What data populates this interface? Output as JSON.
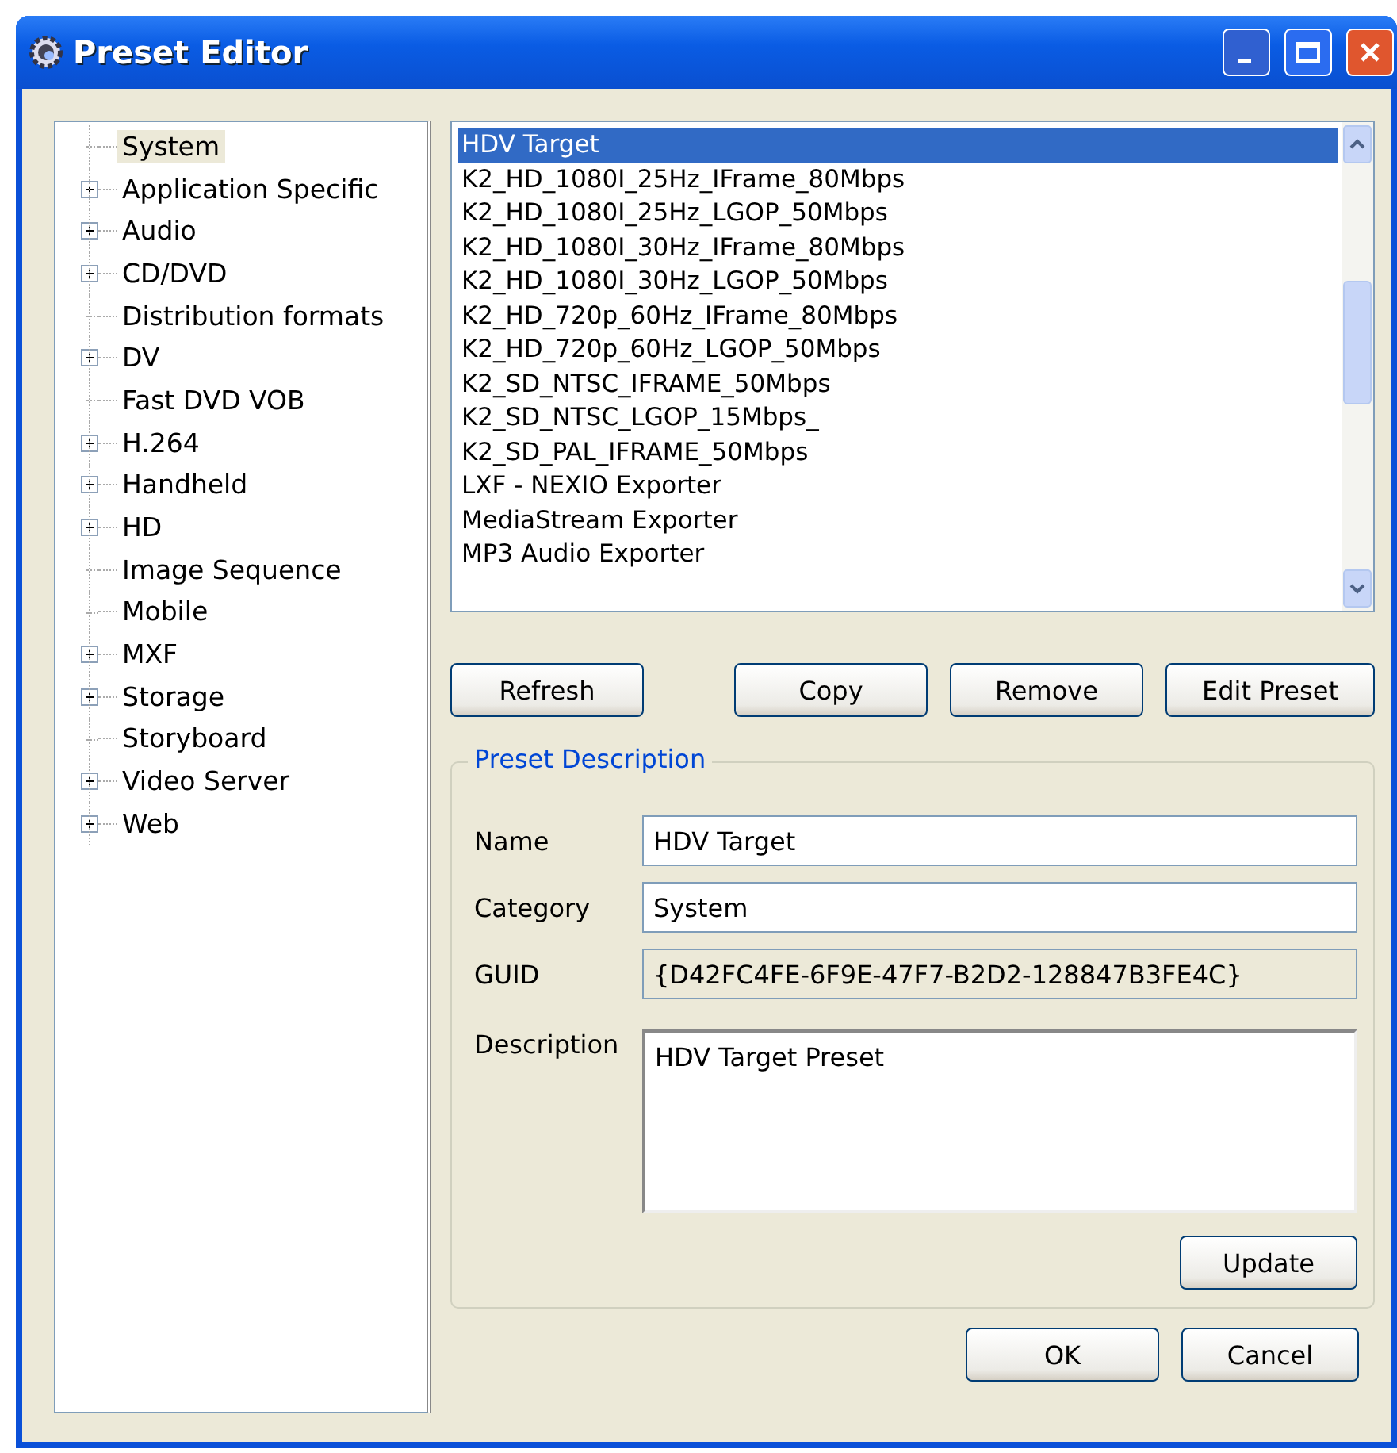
{
  "window": {
    "title": "Preset Editor"
  },
  "tree": {
    "items": [
      {
        "label": "System",
        "kind": "leaf",
        "selected": true
      },
      {
        "label": "Application Specific",
        "kind": "folder",
        "expanded": false,
        "selected": false
      },
      {
        "label": "Audio",
        "kind": "folder",
        "expanded": false,
        "selected": false
      },
      {
        "label": "CD/DVD",
        "kind": "folder",
        "expanded": false,
        "selected": false
      },
      {
        "label": "Distribution formats",
        "kind": "leaf",
        "selected": false
      },
      {
        "label": "DV",
        "kind": "folder",
        "expanded": false,
        "selected": false
      },
      {
        "label": "Fast DVD VOB",
        "kind": "leaf",
        "selected": false
      },
      {
        "label": "H.264",
        "kind": "folder",
        "expanded": false,
        "selected": false
      },
      {
        "label": "Handheld",
        "kind": "folder",
        "expanded": false,
        "selected": false
      },
      {
        "label": "HD",
        "kind": "folder",
        "expanded": false,
        "selected": false
      },
      {
        "label": "Image Sequence",
        "kind": "leaf",
        "selected": false
      },
      {
        "label": "Mobile",
        "kind": "leaf",
        "selected": false
      },
      {
        "label": "MXF",
        "kind": "folder",
        "expanded": false,
        "selected": false
      },
      {
        "label": "Storage",
        "kind": "folder",
        "expanded": false,
        "selected": false
      },
      {
        "label": "Storyboard",
        "kind": "leaf",
        "selected": false
      },
      {
        "label": "Video Server",
        "kind": "folder",
        "expanded": false,
        "selected": false
      },
      {
        "label": "Web",
        "kind": "folder",
        "expanded": false,
        "selected": false
      }
    ]
  },
  "presets": {
    "items": [
      {
        "label": "HDV Target",
        "selected": true
      },
      {
        "label": "K2_HD_1080I_25Hz_IFrame_80Mbps",
        "selected": false
      },
      {
        "label": "K2_HD_1080I_25Hz_LGOP_50Mbps",
        "selected": false
      },
      {
        "label": "K2_HD_1080I_30Hz_IFrame_80Mbps",
        "selected": false
      },
      {
        "label": "K2_HD_1080I_30Hz_LGOP_50Mbps",
        "selected": false
      },
      {
        "label": "K2_HD_720p_60Hz_IFrame_80Mbps",
        "selected": false
      },
      {
        "label": "K2_HD_720p_60Hz_LGOP_50Mbps",
        "selected": false
      },
      {
        "label": "K2_SD_NTSC_IFRAME_50Mbps",
        "selected": false
      },
      {
        "label": "K2_SD_NTSC_LGOP_15Mbps_",
        "selected": false
      },
      {
        "label": "K2_SD_PAL_IFRAME_50Mbps",
        "selected": false
      },
      {
        "label": "LXF - NEXIO Exporter",
        "selected": false
      },
      {
        "label": "MediaStream Exporter",
        "selected": false
      },
      {
        "label": "MP3 Audio Exporter",
        "selected": false
      }
    ]
  },
  "actions": {
    "refresh": "Refresh",
    "copy": "Copy",
    "remove": "Remove",
    "edit": "Edit Preset"
  },
  "description_group": {
    "title": "Preset Description",
    "fields": [
      {
        "label": "Name",
        "value": "HDV Target",
        "disabled": false
      },
      {
        "label": "Category",
        "value": "System",
        "disabled": false
      },
      {
        "label": "GUID",
        "value": "{D42FC4FE-6F9E-47F7-B2D2-128847B3FE4C}",
        "disabled": true
      }
    ],
    "description_label": "Description",
    "description": "HDV Target Preset",
    "update": "Update"
  },
  "buttons": {
    "ok": "OK",
    "cancel": "Cancel"
  }
}
